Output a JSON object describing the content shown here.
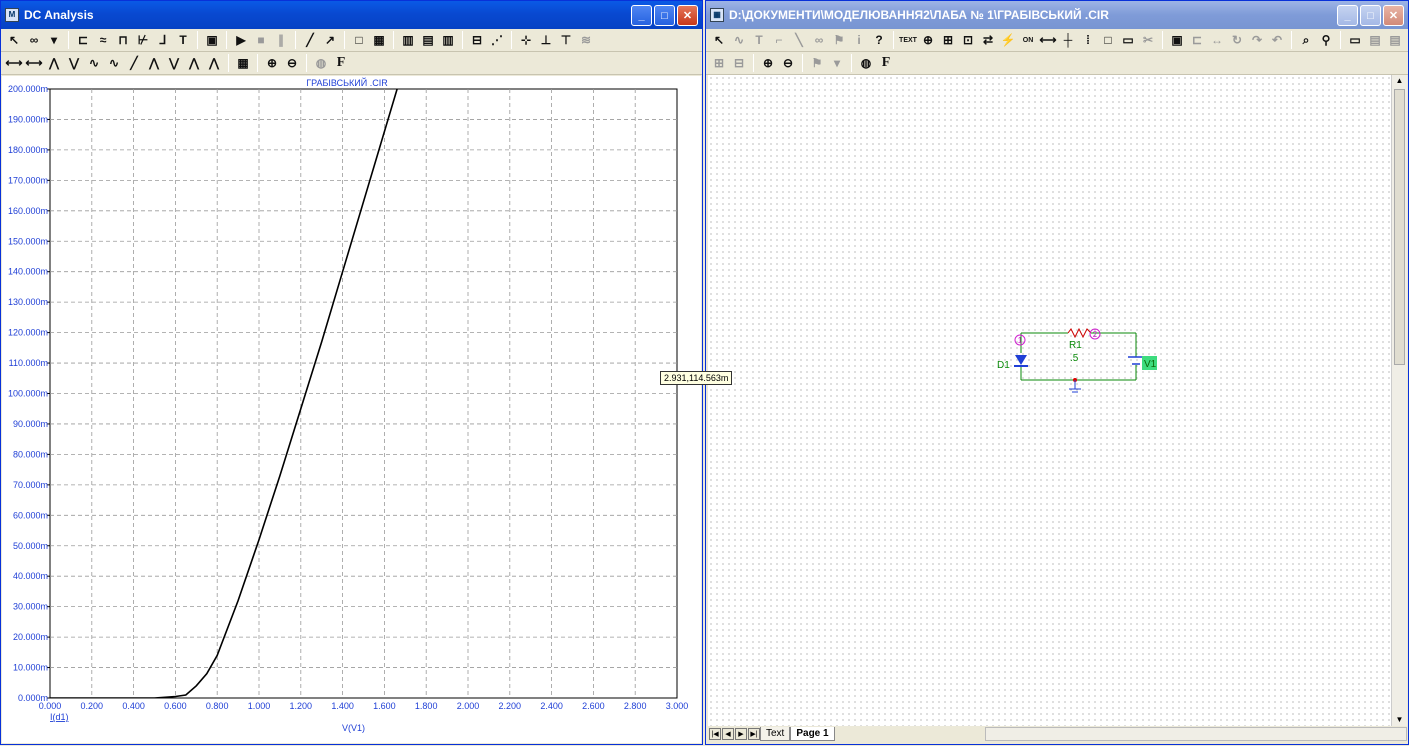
{
  "left_window": {
    "title": "DC Analysis",
    "plot_title": "ГРАБІВСЬКИЙ .CIR",
    "cursor_tooltip": "2.931,114.563m"
  },
  "right_window": {
    "title": "D:\\ДОКУМЕНТИ\\МОДЕЛЮВАННЯ2\\ЛАБА № 1\\ГРАБІВСЬКИЙ .CIR"
  },
  "chart_data": {
    "type": "line",
    "title": "ГРАБІВСЬКИЙ .CIR",
    "xlabel": "V(V1)",
    "ylabel": "I(d1)",
    "xlim": [
      0,
      3.0
    ],
    "ylim": [
      0,
      0.2
    ],
    "x_ticks": [
      "0.000",
      "0.200",
      "0.400",
      "0.600",
      "0.800",
      "1.000",
      "1.200",
      "1.400",
      "1.600",
      "1.800",
      "2.000",
      "2.200",
      "2.400",
      "2.600",
      "2.800",
      "3.000"
    ],
    "y_ticks": [
      "0.000m",
      "10.000m",
      "20.000m",
      "30.000m",
      "40.000m",
      "50.000m",
      "60.000m",
      "70.000m",
      "80.000m",
      "90.000m",
      "100.000m",
      "110.000m",
      "120.000m",
      "130.000m",
      "140.000m",
      "150.000m",
      "160.000m",
      "170.000m",
      "180.000m",
      "190.000m",
      "200.000m"
    ],
    "grid": true,
    "series": [
      {
        "name": "I(d1)",
        "color": "#000000",
        "x": [
          0,
          0.5,
          0.6,
          0.65,
          0.7,
          0.75,
          0.8,
          0.9,
          1.0,
          1.1,
          1.2,
          1.3,
          1.4,
          1.5,
          1.6,
          1.7,
          1.8
        ],
        "y": [
          0,
          0,
          0.0005,
          0.001,
          0.004,
          0.008,
          0.014,
          0.032,
          0.052,
          0.073,
          0.095,
          0.117,
          0.14,
          0.163,
          0.186,
          0.209,
          0.232
        ]
      }
    ]
  },
  "schematic": {
    "diode_label": "D1",
    "resistor_label": "R1",
    "resistor_value": ".5",
    "source_label": "V1",
    "node1": "1",
    "node2": "2"
  },
  "tabs": {
    "text": "Text",
    "page1": "Page 1"
  }
}
